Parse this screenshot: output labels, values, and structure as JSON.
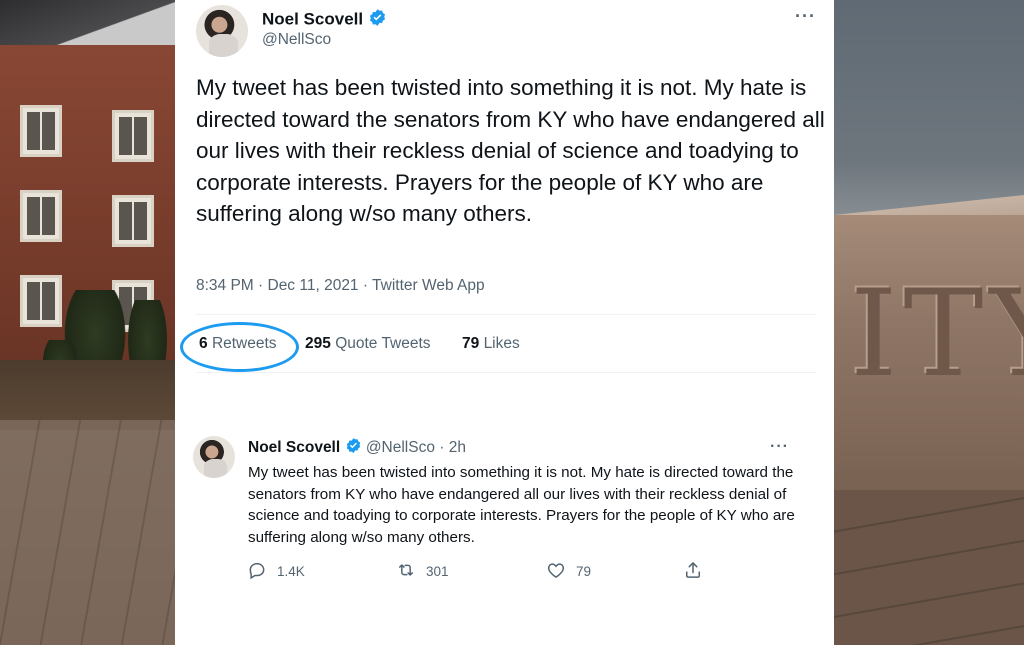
{
  "main_tweet": {
    "author_name": "Noel Scovell",
    "handle": "@NellSco",
    "text": "My tweet has been twisted into something it is not. My hate is directed toward the senators from KY who have endangered all our lives with their reckless denial of science and toadying to corporate interests. Prayers for the people of KY who are suffering along w/so many others.",
    "timestamp": "8:34 PM · Dec 11, 2021 · Twitter Web App",
    "more_label": "···",
    "stats": {
      "retweets_count": "6",
      "retweets_label": "Retweets",
      "quotes_count": "295",
      "quotes_label": "Quote Tweets",
      "likes_count": "79",
      "likes_label": "Likes"
    }
  },
  "timeline_tweet": {
    "author_name": "Noel Scovell",
    "handle": "@NellSco",
    "separator": "·",
    "age": "2h",
    "more_label": "···",
    "text": "My tweet has been twisted into something it is not. My hate is directed toward the senators from KY who have endangered all our lives with their reckless denial of science and toadying to corporate interests. Prayers for the people of KY who are suffering along w/so many others.",
    "actions": {
      "replies": "1.4K",
      "retweets": "301",
      "likes": "79"
    }
  },
  "background_carving": "ITY",
  "colors": {
    "accent": "#1d9bf0",
    "text_primary": "#0f1419",
    "text_secondary": "#536471"
  }
}
